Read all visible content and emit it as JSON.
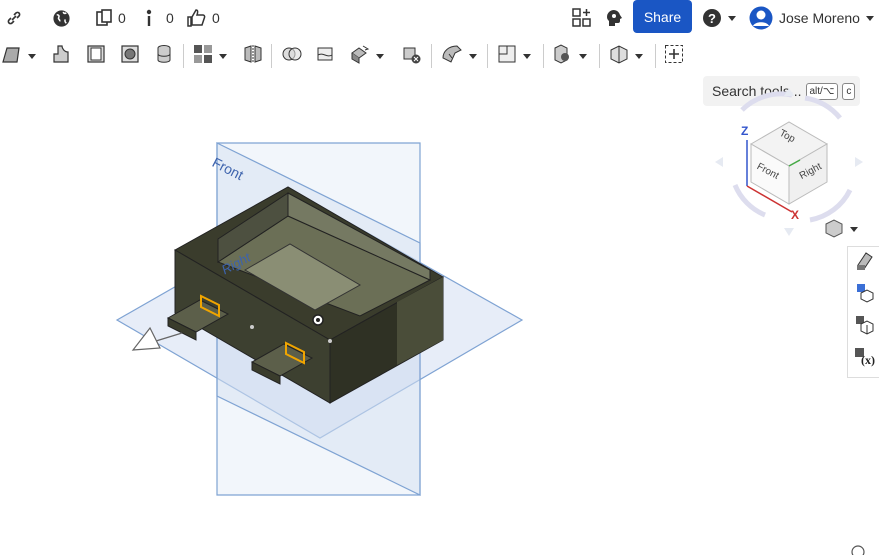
{
  "topbar": {
    "icons": [
      "link-icon",
      "globe-icon",
      "clipboard-icon",
      "pin-icon",
      "thumbs-up-icon"
    ],
    "clipboard_count": "0",
    "pin_count": "0",
    "likes_count": "0",
    "share_label": "Share",
    "user_name": "Jose Moreno"
  },
  "toolbar": {
    "tools": [
      "extrude-tool",
      "revolve-tool",
      "shell-tool",
      "fillet-tool",
      "chamfer-tool",
      "boolean-tool",
      "split-tool",
      "transform-tool",
      "delete-part-tool",
      "sheet-metal-tool",
      "plane-tool",
      "mate-tool",
      "section-view-tool",
      "add-tool"
    ],
    "search_label": "Search tools...",
    "search_shortcut": "alt/⌥",
    "search_key": "c"
  },
  "viewport": {
    "plane_labels": {
      "front": "Front",
      "right": "Right"
    },
    "view_cube": {
      "top": "Top",
      "front": "Front",
      "right": "Right",
      "axis_z": "Z",
      "axis_x": "X"
    },
    "colors": {
      "plane_fill": "#c9d7ef",
      "plane_edge": "#7fa3d3",
      "part_dark": "#3a3c2c",
      "part_mid": "#575a45",
      "highlight": "#f0a500"
    }
  },
  "right_panel": {
    "buttons": [
      "appearance-icon",
      "part-studio-icon",
      "assembly-icon",
      "variables-icon"
    ]
  }
}
